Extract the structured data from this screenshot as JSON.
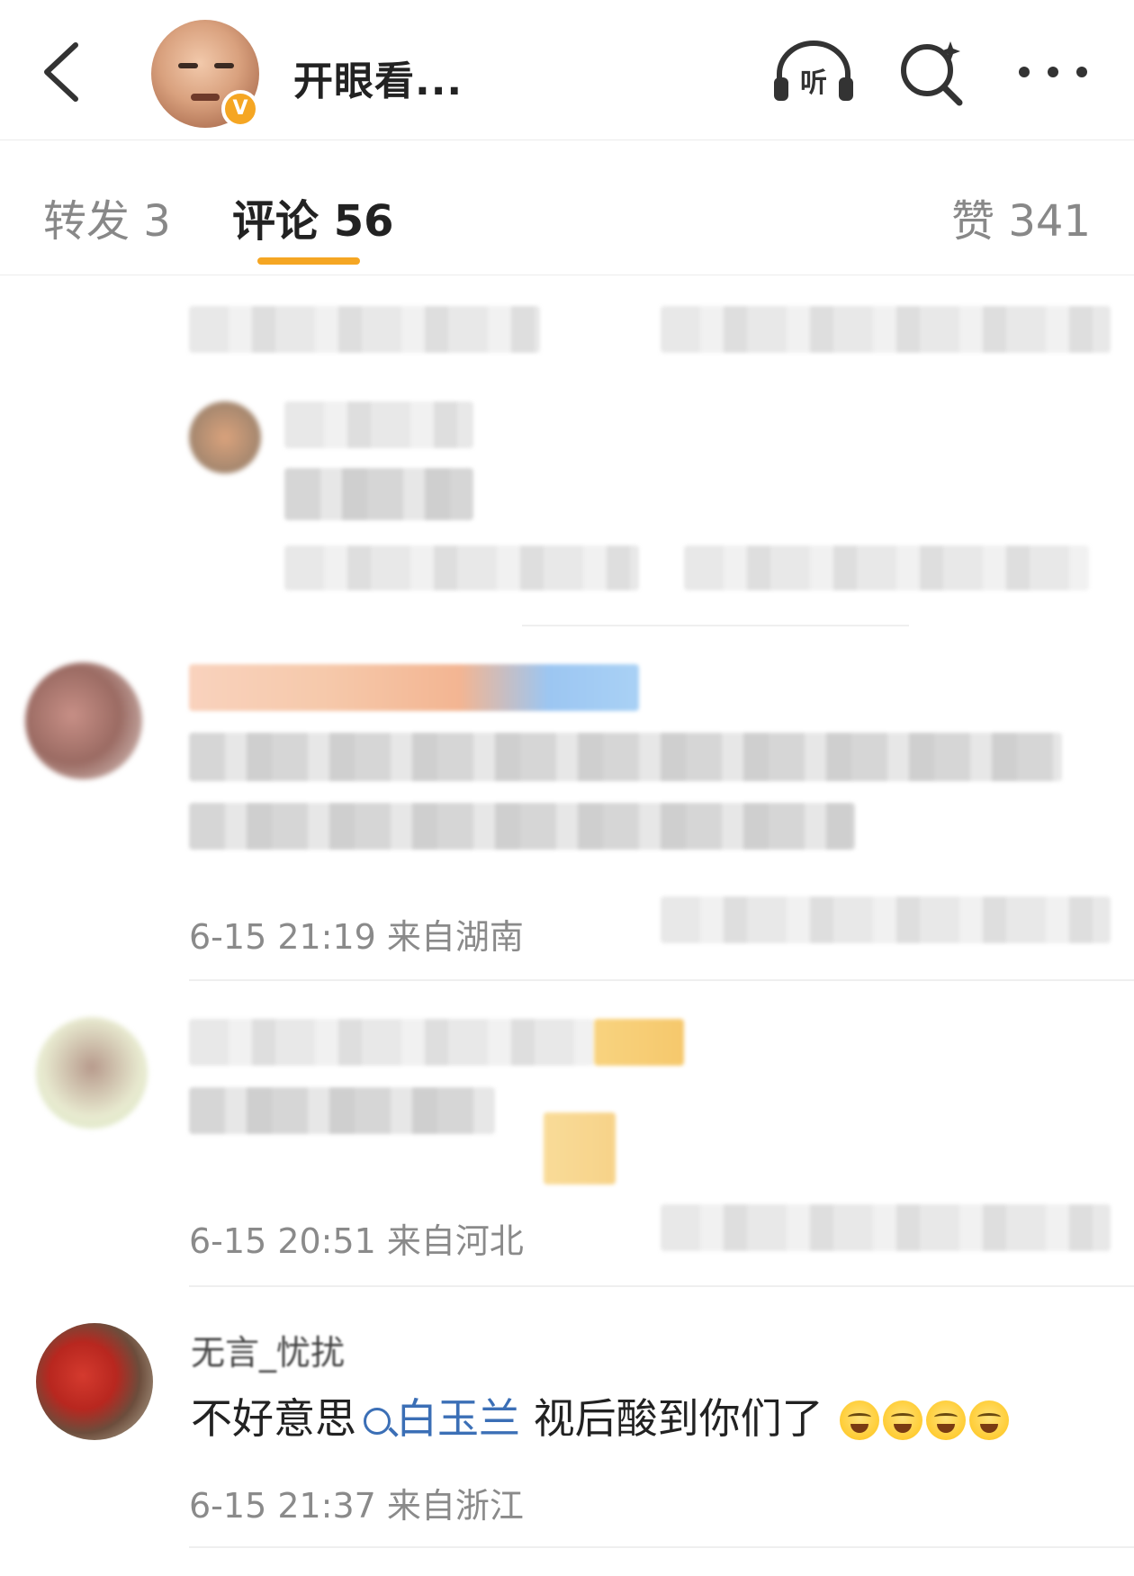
{
  "header": {
    "title": "开眼看...",
    "verified_badge": "V",
    "icons": [
      "back-icon",
      "listen-icon",
      "search-icon",
      "more-icon"
    ],
    "listen_label": "听"
  },
  "tabs": {
    "repost": "转发 3",
    "comment": "评论 56",
    "like": "赞 341",
    "active": "comment",
    "accent_color": "#f5a623"
  },
  "comments": [
    {
      "meta": "6-15 21:19 来自湖南"
    },
    {
      "meta": "6-15 20:51 来自河北"
    },
    {
      "name": "无言_忧扰",
      "text_before": "不好意思",
      "mention": "白玉兰",
      "text_after": " 视后酸到你们了",
      "emoji_count": 4,
      "emoji_name": "laughing-crying-emoji",
      "meta": "6-15 21:37 来自浙江"
    }
  ],
  "colors": {
    "mention": "#3b6fb6",
    "meta": "#8a8a8a",
    "badge": "#f5a623"
  }
}
